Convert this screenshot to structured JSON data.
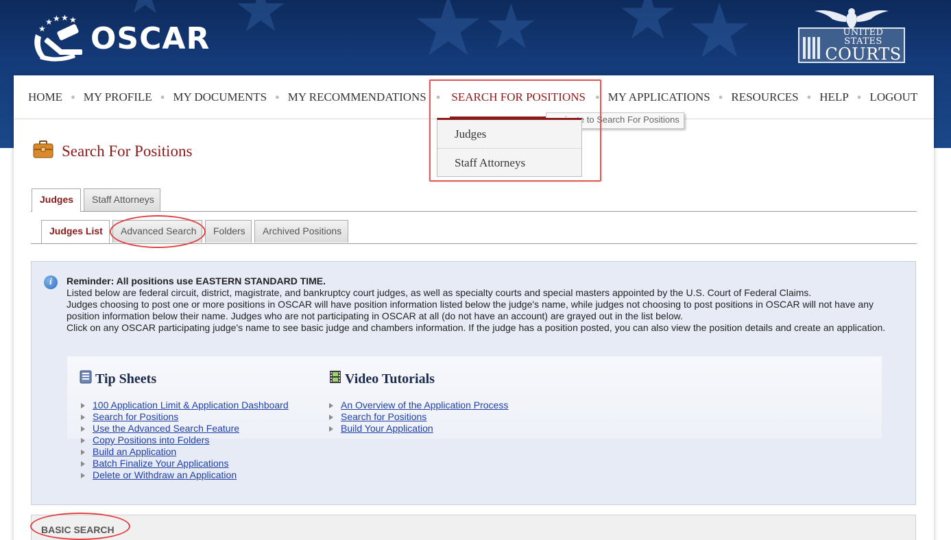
{
  "header": {
    "brand": "OSCAR",
    "courts_logo_top": "UNITED STATES",
    "courts_logo_bottom": "COURTS"
  },
  "nav": {
    "items": [
      {
        "label": "HOME"
      },
      {
        "label": "MY PROFILE"
      },
      {
        "label": "MY DOCUMENTS"
      },
      {
        "label": "MY RECOMMENDATIONS"
      },
      {
        "label": "SEARCH FOR POSITIONS",
        "active": true
      },
      {
        "label": "MY APPLICATIONS"
      },
      {
        "label": "RESOURCES"
      },
      {
        "label": "HELP"
      },
      {
        "label": "LOGOUT"
      }
    ],
    "separator": "●",
    "tooltip": "navigate to Search For Positions",
    "dropdown": [
      "Judges",
      "Staff Attorneys"
    ]
  },
  "page": {
    "title": "Search For Positions",
    "title_icon": "briefcase-icon"
  },
  "tabs": {
    "primary": [
      {
        "label": "Judges",
        "active": true
      },
      {
        "label": "Staff Attorneys"
      }
    ],
    "secondary": [
      {
        "label": "Judges List",
        "active": true
      },
      {
        "label": "Advanced Search"
      },
      {
        "label": "Folders"
      },
      {
        "label": "Archived Positions"
      }
    ]
  },
  "info": {
    "reminder": "Reminder: All positions use EASTERN STANDARD TIME.",
    "line1": "Listed below are federal circuit, district, magistrate, and bankruptcy court judges, as well as specialty courts and special masters appointed by the U.S. Court of Federal Claims.",
    "line2": "Judges choosing to post one or more positions in OSCAR will have position information listed below the judge's name, while judges not choosing to post positions in OSCAR will not have any position information below their name.  Judges who are not participating in OSCAR at all (do not have an account) are grayed out in the list below.",
    "line3": "Click on any OSCAR participating judge's name to see basic judge and chambers information.  If the judge has a position posted, you can also view the position details and create an application."
  },
  "tip_sheets": {
    "heading": "Tip Sheets",
    "links": [
      "100 Application Limit & Application Dashboard",
      "Search for Positions",
      "Use the Advanced Search Feature",
      "Copy Positions into Folders",
      "Build an Application",
      "Batch Finalize Your Applications",
      "Delete or Withdraw an Application"
    ]
  },
  "video_tutorials": {
    "heading": "Video Tutorials",
    "links": [
      "An Overview of the Application Process",
      "Search for Positions",
      "Build Your Application"
    ]
  },
  "basic_search": {
    "label": "BASIC SEARCH"
  },
  "colors": {
    "brand_red": "#8b1a1a",
    "banner_blue": "#143a78",
    "link_blue": "#1f3fa8",
    "annotation_red": "#e05a5a"
  }
}
